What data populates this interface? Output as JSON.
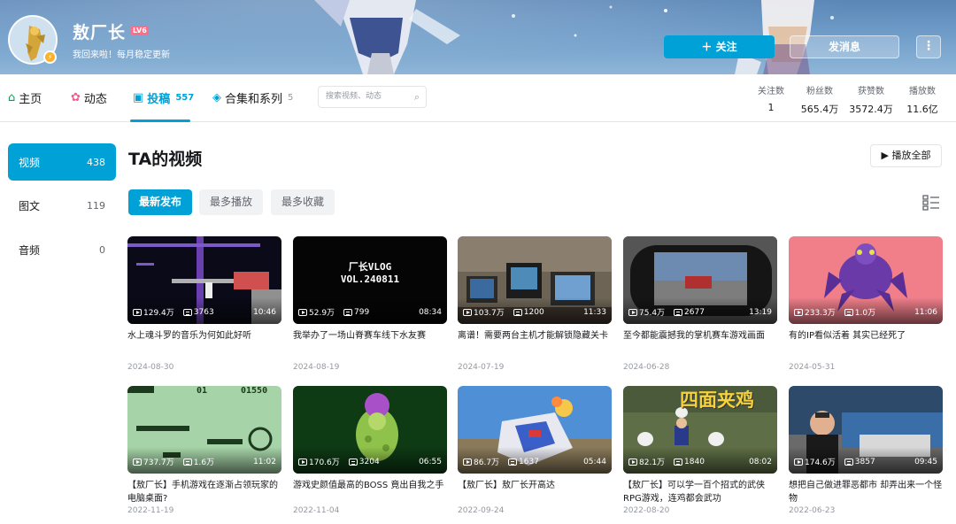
{
  "header": {
    "username": "敖厂长",
    "level": "LV6",
    "sign": "我回来啦！每月稳定更新",
    "follow_label": "关注",
    "message_label": "发消息",
    "more_label": "⋮"
  },
  "nav": {
    "items": [
      {
        "label": "主页",
        "icon": "home-icon"
      },
      {
        "label": "动态",
        "icon": "pinwheel-icon"
      },
      {
        "label": "投稿",
        "icon": "tv-icon",
        "count": "557"
      },
      {
        "label": "合集和系列",
        "icon": "layers-icon",
        "count": "5"
      }
    ],
    "search_placeholder": "搜索视频、动态"
  },
  "stats": [
    {
      "label": "关注数",
      "value": "1"
    },
    {
      "label": "粉丝数",
      "value": "565.4万"
    },
    {
      "label": "获赞数",
      "value": "3572.4万"
    },
    {
      "label": "播放数",
      "value": "11.6亿"
    }
  ],
  "sidebar": [
    {
      "label": "视频",
      "count": "438"
    },
    {
      "label": "图文",
      "count": "119"
    },
    {
      "label": "音频",
      "count": "0"
    }
  ],
  "main": {
    "title": "TA的视频",
    "play_all": "播放全部",
    "filters": [
      "最新发布",
      "最多播放",
      "最多收藏"
    ]
  },
  "videos": [
    {
      "plays": "129.4万",
      "danmaku": "3763",
      "duration": "10:46",
      "title": "水上魂斗罗的音乐为何如此好听",
      "date": "2024-08-30"
    },
    {
      "plays": "52.9万",
      "danmaku": "799",
      "duration": "08:34",
      "title": "我举办了一场山脊赛车线下水友赛",
      "date": "2024-08-19",
      "overlay": [
        "厂长VLOG",
        "VOL.240811"
      ]
    },
    {
      "plays": "103.7万",
      "danmaku": "1200",
      "duration": "11:33",
      "title": "离谱！需要两台主机才能解锁隐藏关卡",
      "date": "2024-07-19"
    },
    {
      "plays": "75.4万",
      "danmaku": "2677",
      "duration": "13:19",
      "title": "至今都能震撼我的掌机赛车游戏画面",
      "date": "2024-06-28"
    },
    {
      "plays": "233.3万",
      "danmaku": "1.0万",
      "duration": "11:06",
      "title": "有的IP看似活着 其实已经死了",
      "date": "2024-05-31"
    },
    {
      "plays": "737.7万",
      "danmaku": "1.6万",
      "duration": "11:02",
      "title": "【敖厂长】手机游戏在逐渐占领玩家的电脑桌面?",
      "date": "2022-11-19",
      "overlay": [
        "01",
        "01550"
      ]
    },
    {
      "plays": "170.6万",
      "danmaku": "3204",
      "duration": "06:55",
      "title": "游戏史颜值最高的BOSS 竟出自我之手",
      "date": "2022-11-04"
    },
    {
      "plays": "86.7万",
      "danmaku": "1637",
      "duration": "05:44",
      "title": "【敖厂长】敖厂长开高达",
      "date": "2022-09-24"
    },
    {
      "plays": "82.1万",
      "danmaku": "1840",
      "duration": "08:02",
      "title": "【敖厂长】可以学一百个招式的武侠RPG游戏，连鸡都会武功",
      "date": "2022-08-20",
      "overlay": [
        "四面夹鸡"
      ]
    },
    {
      "plays": "174.6万",
      "danmaku": "3857",
      "duration": "09:45",
      "title": "想把自己做进罪恶都市 却弄出来一个怪物",
      "date": "2022-06-23"
    }
  ],
  "colors": {
    "accent": "#00a1d6",
    "text": "#18191c",
    "muted": "#9499a0"
  }
}
